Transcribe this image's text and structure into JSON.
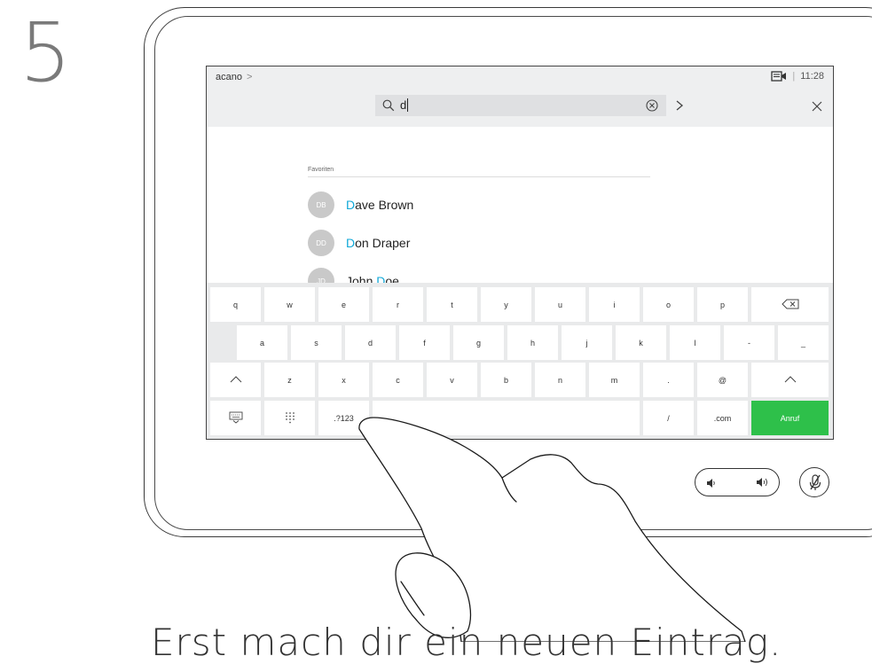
{
  "step": {
    "number": "5"
  },
  "header": {
    "breadcrumb": "acano",
    "breadcrumb_chevron": ">",
    "separator": "|",
    "time": "11:28",
    "camera_icon": "camera-self-view-icon"
  },
  "search": {
    "value": "d",
    "search_icon": "magnifier-icon",
    "clear_icon": "clear-circle-x-icon",
    "go_icon": "chevron-right-icon",
    "close_icon": "close-x-icon"
  },
  "favorites": {
    "label": "Favoriten",
    "contacts": [
      {
        "initials": "DB",
        "match": "D",
        "rest": "ave Brown"
      },
      {
        "initials": "DD",
        "match": "D",
        "rest": "on Draper"
      },
      {
        "initials": "JD",
        "prefix": "John ",
        "match": "D",
        "rest": "oe"
      }
    ]
  },
  "keyboard": {
    "row1": [
      "q",
      "w",
      "e",
      "r",
      "t",
      "y",
      "u",
      "i",
      "o",
      "p"
    ],
    "row1_backspace_icon": "backspace-icon",
    "row2": [
      "a",
      "s",
      "d",
      "f",
      "g",
      "h",
      "j",
      "k",
      "l",
      "-",
      "_"
    ],
    "row3": [
      "z",
      "x",
      "c",
      "v",
      "b",
      "n",
      "m",
      ".",
      "@"
    ],
    "row3_shift_icon": "shift-up-icon",
    "row4": {
      "hide_icon": "keyboard-hide-icon",
      "dialpad_icon": "dialpad-icon",
      "numbers": ".?123",
      "space": "",
      "slash": "/",
      "dotcom": ".com",
      "call": "Anruf"
    }
  },
  "controls": {
    "volume_low_icon": "volume-low-icon",
    "volume_high_icon": "volume-high-icon",
    "mute_icon": "microphone-muted-icon"
  },
  "caption": "Erst mach dir ein neuen Eintrag.",
  "colors": {
    "highlight": "#10a8d8",
    "call": "#2ec04a"
  }
}
